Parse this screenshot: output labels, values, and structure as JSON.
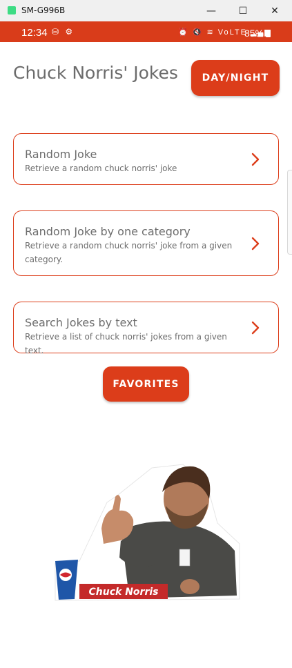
{
  "window": {
    "title": "SM-G996B",
    "minimize": "—",
    "maximize": "☐",
    "close": "✕"
  },
  "statusbar": {
    "time": "12:34",
    "left_icons": "⛁ ⚙",
    "right_icons": "⏰ 🔇 ≋ VoLTE ▂▄▆",
    "battery": "85%"
  },
  "app": {
    "title": "Chuck Norris' Jokes",
    "day_night_label": "DAY/NIGHT",
    "cards": [
      {
        "title": "Random Joke",
        "description": "Retrieve a random chuck norris' joke"
      },
      {
        "title": "Random Joke by one category",
        "description": "Retrieve a random chuck norris' joke from a given category."
      },
      {
        "title": "Search Jokes by text",
        "description": "Retrieve a list of chuck norris' jokes from a given text."
      }
    ],
    "favorites_label": "FAVORITES",
    "illustration": {
      "banner_text": "Chuck Norris",
      "icon": "chuck-norris-thumbs-up-image"
    }
  },
  "colors": {
    "accent": "#dc3d1a",
    "statusbar": "#d93c1a",
    "text_gray": "#6b6b6b"
  }
}
